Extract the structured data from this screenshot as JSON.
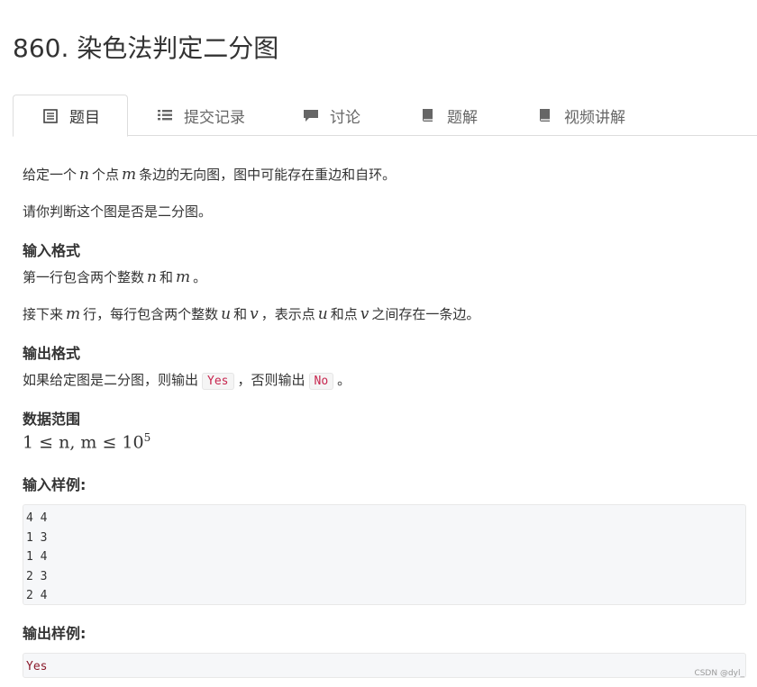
{
  "problem": {
    "title": "860. 染色法判定二分图"
  },
  "tabs": [
    {
      "label": "题目",
      "icon": "document-icon",
      "active": true
    },
    {
      "label": "提交记录",
      "icon": "list-icon",
      "active": false
    },
    {
      "label": "讨论",
      "icon": "chat-icon",
      "active": false
    },
    {
      "label": "题解",
      "icon": "book-icon",
      "active": false
    },
    {
      "label": "视频讲解",
      "icon": "book-icon",
      "active": false
    }
  ],
  "description": {
    "line1": {
      "a": "给定一个",
      "n": "n",
      "b": "个点",
      "m": "m",
      "c": "条边的无向图，图中可能存在重边和自环。"
    },
    "line2": "请你判断这个图是否是二分图。"
  },
  "input_format": {
    "heading": "输入格式",
    "line1": {
      "a": "第一行包含两个整数",
      "n": "n",
      "b": "和",
      "m": "m",
      "c": "。"
    },
    "line2": {
      "a": "接下来",
      "m": "m",
      "b": "行，每行包含两个整数",
      "u": "u",
      "c": "和",
      "v": "v",
      "d": "，表示点",
      "u2": "u",
      "e": "和点",
      "v2": "v",
      "f": "之间存在一条边。"
    }
  },
  "output_format": {
    "heading": "输出格式",
    "a": "如果给定图是二分图，则输出",
    "yes": "Yes",
    "b": "，否则输出",
    "no": "No",
    "c": "。"
  },
  "data_range": {
    "heading": "数据范围",
    "expr": "1 ≤ n, m ≤ 10",
    "exp": "5"
  },
  "sample_input": {
    "heading": "输入样例:",
    "code": "4 4\n1 3\n1 4\n2 3\n2 4"
  },
  "sample_output": {
    "heading": "输出样例:",
    "code": "Yes"
  },
  "watermark": "CSDN @dyl_",
  "colors": {
    "code_inline": "#c7254e",
    "code_bg": "#f6f7f9",
    "border": "#dddddd"
  }
}
